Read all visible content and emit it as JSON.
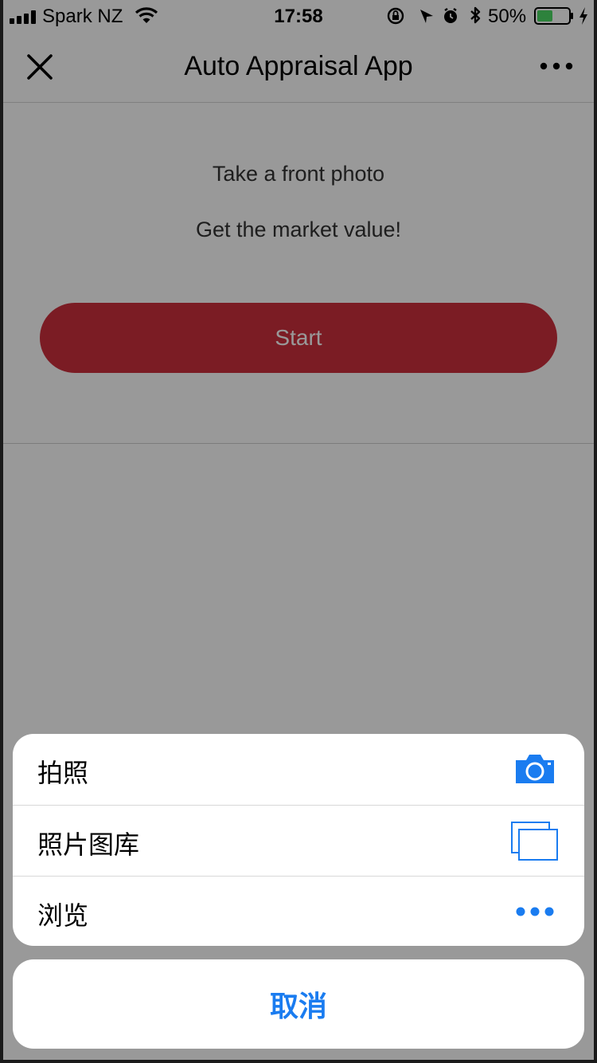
{
  "status_bar": {
    "carrier": "Spark NZ",
    "time": "17:58",
    "battery_percent": "50%",
    "battery_level": 0.5,
    "icons": [
      "signal-icon",
      "wifi-icon",
      "rotation-lock-icon",
      "location-icon",
      "alarm-icon",
      "bluetooth-icon",
      "battery-icon",
      "charging-icon"
    ]
  },
  "navbar": {
    "title": "Auto Appraisal App",
    "left_icon": "close-icon",
    "right_icon": "more-icon"
  },
  "content": {
    "line1": "Take a front photo",
    "line2": "Get the market value!",
    "start_label": "Start",
    "start_color": "#ce2f3d"
  },
  "action_sheet": {
    "items": [
      {
        "label": "拍照",
        "icon": "camera-icon"
      },
      {
        "label": "照片图库",
        "icon": "photo-library-icon"
      },
      {
        "label": "浏览",
        "icon": "ellipsis-icon"
      }
    ],
    "cancel_label": "取消",
    "accent_color": "#1a7cf0"
  }
}
